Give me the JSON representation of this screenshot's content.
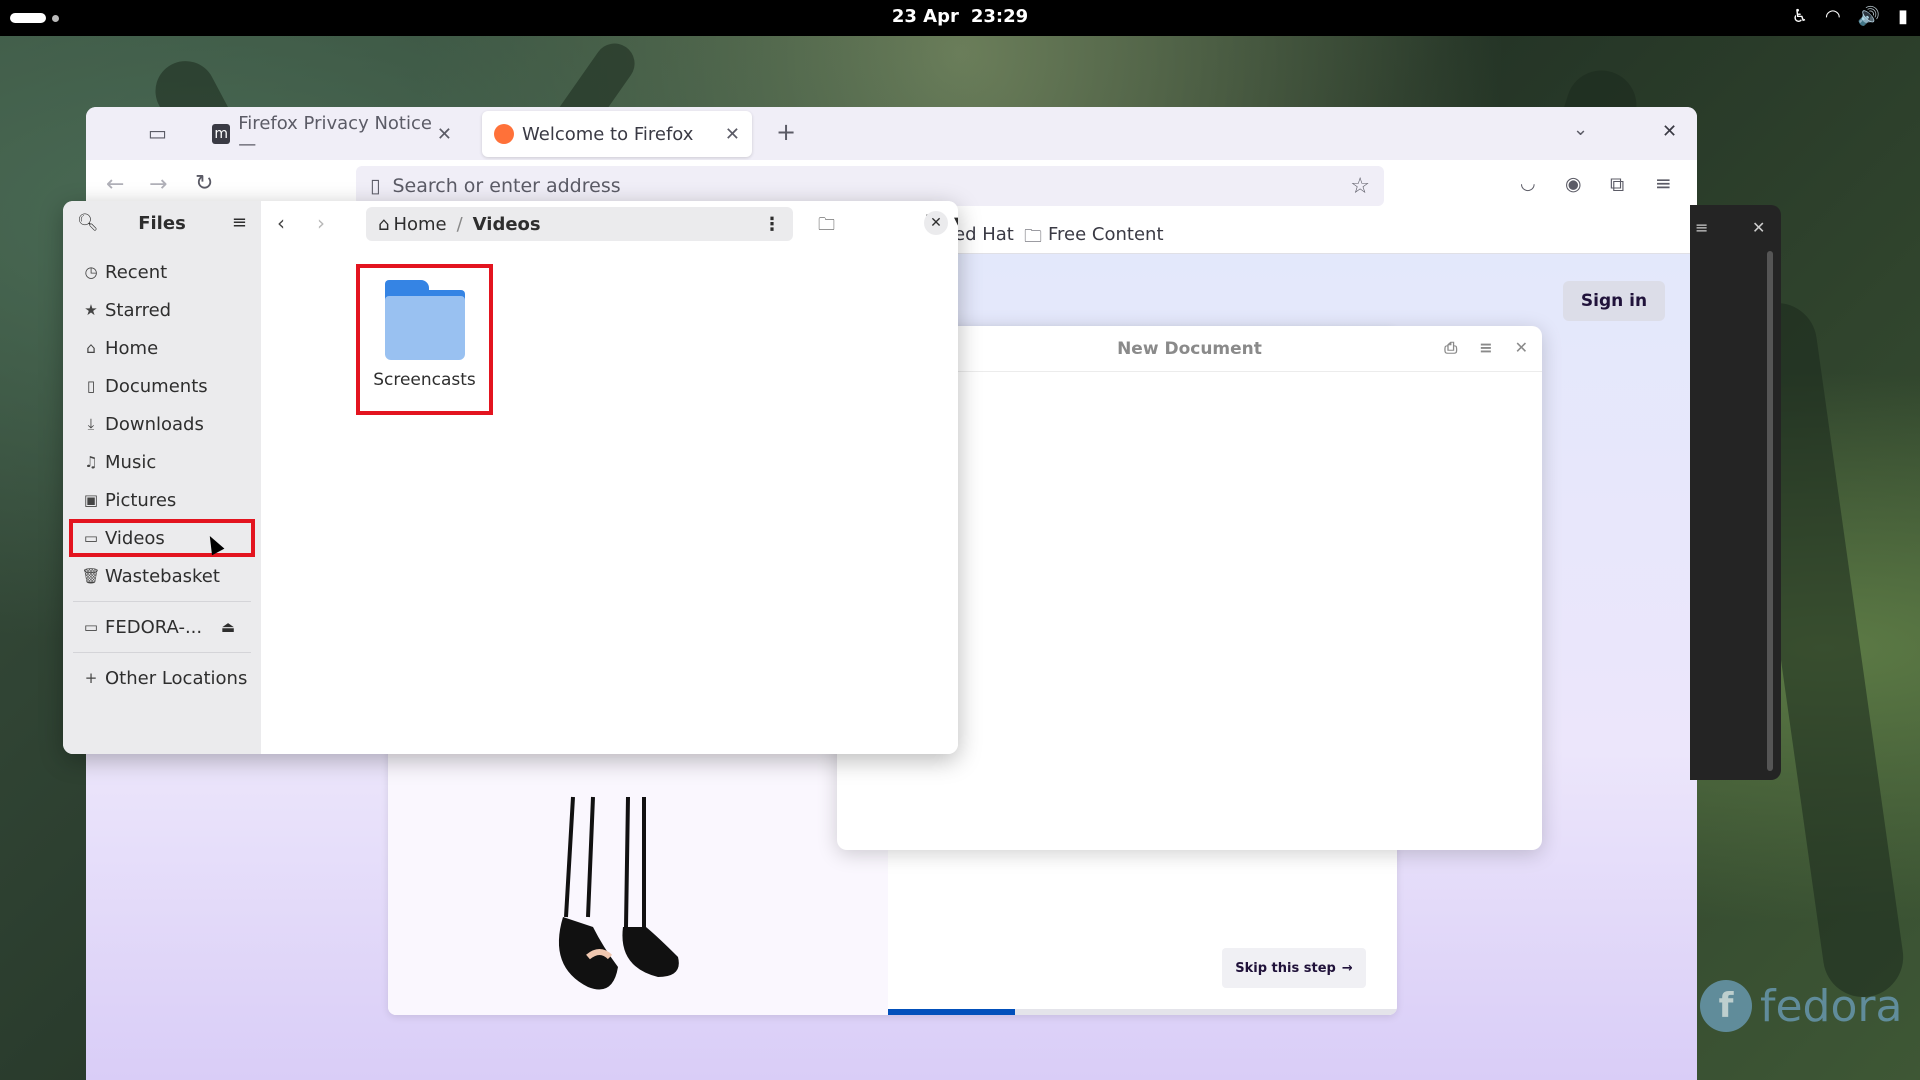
{
  "topbar": {
    "date": "23 Apr",
    "time": "23:29",
    "tray_icons": [
      "accessibility-icon",
      "wifi-icon",
      "volume-icon",
      "battery-icon"
    ]
  },
  "firefox": {
    "tabs": [
      {
        "label": "Firefox Privacy Notice —",
        "active": false
      },
      {
        "label": "Welcome to Firefox",
        "active": true
      }
    ],
    "url_placeholder": "Search or enter address",
    "bookmarks": [
      {
        "label": "ed Hat"
      },
      {
        "label": "Free Content"
      }
    ],
    "sign_in": "Sign in",
    "skip_step": "Skip this step",
    "onboarding_progress": 0.25
  },
  "gedit": {
    "title": "New Document"
  },
  "files": {
    "title": "Files",
    "sidebar": {
      "items": [
        {
          "label": "Recent",
          "icon": "clock-icon"
        },
        {
          "label": "Starred",
          "icon": "star-icon"
        },
        {
          "label": "Home",
          "icon": "home-icon"
        },
        {
          "label": "Documents",
          "icon": "document-icon"
        },
        {
          "label": "Downloads",
          "icon": "download-icon"
        },
        {
          "label": "Music",
          "icon": "music-icon"
        },
        {
          "label": "Pictures",
          "icon": "picture-icon"
        },
        {
          "label": "Videos",
          "icon": "video-icon",
          "active": true
        },
        {
          "label": "Wastebasket",
          "icon": "trash-icon"
        }
      ],
      "devices": [
        {
          "label": "FEDORA-...",
          "icon": "drive-icon"
        }
      ],
      "other": {
        "label": "Other Locations",
        "icon": "plus-icon"
      }
    },
    "path": {
      "home": "Home",
      "separator": "/",
      "current": "Videos"
    },
    "items": [
      {
        "label": "Screencasts",
        "type": "folder"
      }
    ]
  },
  "branding": {
    "logo_text": "fedora"
  },
  "colors": {
    "highlight": "#e3141f",
    "folder_blue": "#3584e4",
    "ff_progress": "#0250bb"
  }
}
